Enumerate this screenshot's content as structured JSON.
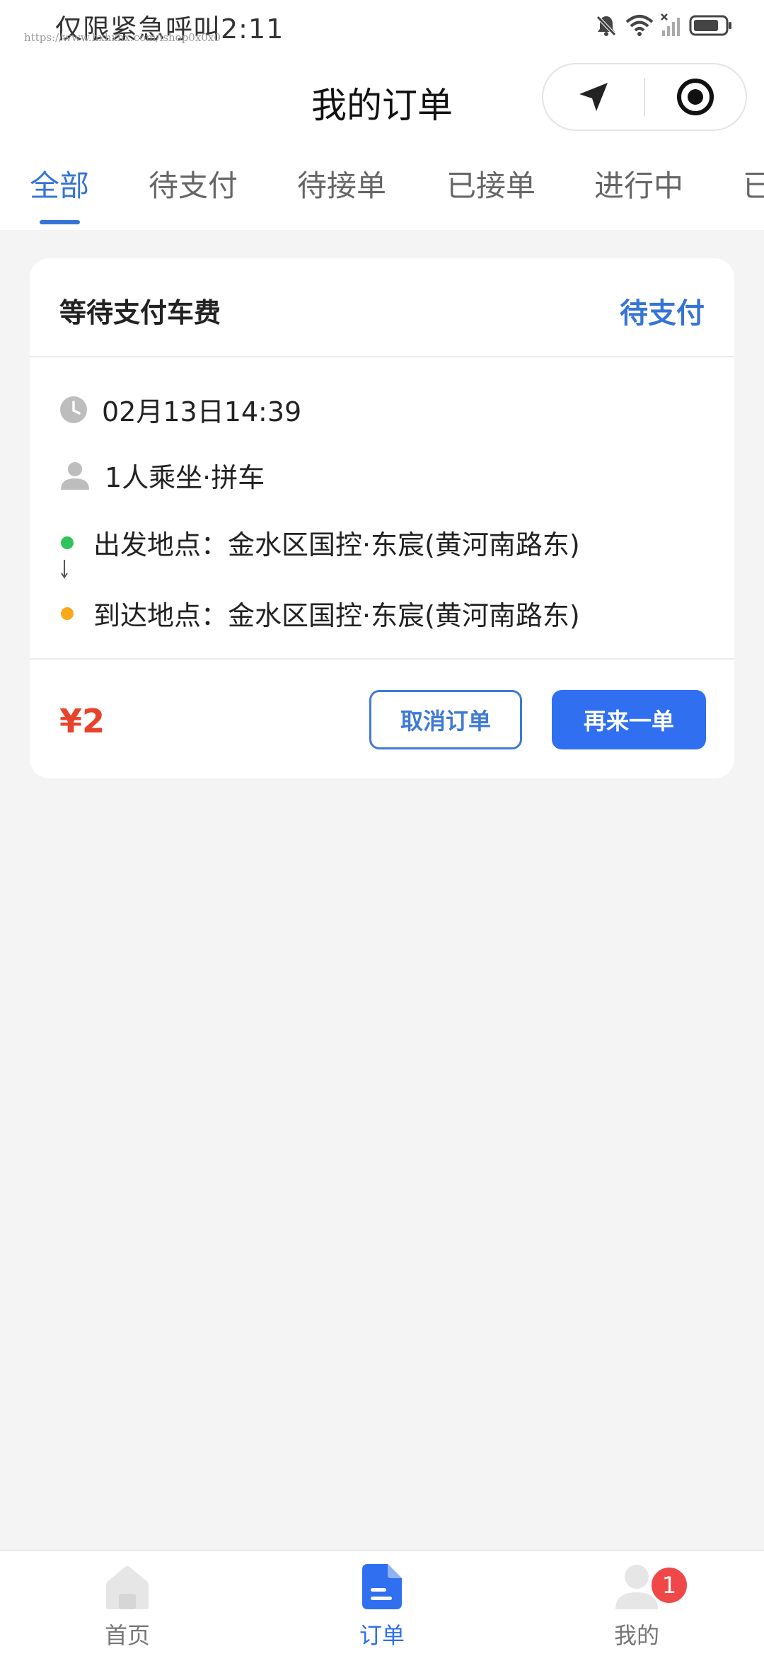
{
  "status_bar": {
    "text": "仅限紧急呼叫2:11",
    "watermark": "https://www.hxhxhx.com/ishop0x0x0"
  },
  "header": {
    "title": "我的订单"
  },
  "tabs": [
    {
      "label": "全部",
      "active": true
    },
    {
      "label": "待支付",
      "active": false
    },
    {
      "label": "待接单",
      "active": false
    },
    {
      "label": "已接单",
      "active": false
    },
    {
      "label": "进行中",
      "active": false
    },
    {
      "label": "已",
      "active": false
    }
  ],
  "order": {
    "title": "等待支付车费",
    "status": "待支付",
    "time": "02月13日14:39",
    "passengers": "1人乘坐·拼车",
    "departure": "出发地点：金水区国控·东宸(黄河南路东)",
    "arrival": "到达地点：金水区国控·东宸(黄河南路东)",
    "price": "¥2",
    "cancel_label": "取消订单",
    "reorder_label": "再来一单"
  },
  "bottom_nav": {
    "items": [
      {
        "label": "首页",
        "icon": "home-icon",
        "active": false
      },
      {
        "label": "订单",
        "icon": "order-icon",
        "active": true
      },
      {
        "label": "我的",
        "icon": "profile-icon",
        "active": false,
        "badge": "1"
      }
    ]
  },
  "colors": {
    "accent": "#3574d4",
    "primary_button": "#2f6ff0",
    "price": "#e8422c",
    "departure_dot": "#2ec45a",
    "arrival_dot": "#f7a81b",
    "badge": "#f04848",
    "background": "#f4f4f4"
  }
}
